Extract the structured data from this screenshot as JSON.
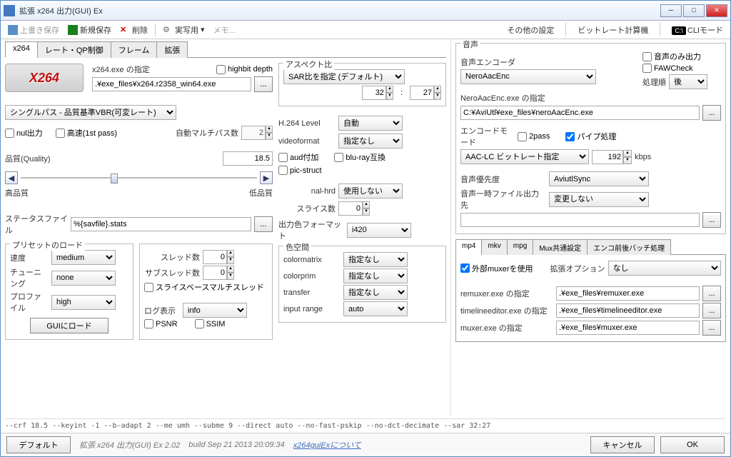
{
  "window": {
    "title": "拡張 x264 出力(GUI) Ex"
  },
  "toolbar": {
    "save": "上書き保存",
    "newsave": "新規保存",
    "delete": "削除",
    "preset": "実写用",
    "memo": "メモ...",
    "other_settings": "その他の設定",
    "bitrate_calc": "ビットレート計算機",
    "cli_mode": "CLIモード"
  },
  "tabs": {
    "x264": "x264",
    "rate": "レート・QP制御",
    "frame": "フレーム",
    "ext": "拡張"
  },
  "logo_text": "X264",
  "x264exe": {
    "label": "x264.exe の指定",
    "highbit": "highbit depth",
    "path": ".¥exe_files¥x264.r2358_win64.exe"
  },
  "mode_combo": "シングルパス - 品質基準VBR(可変レート)",
  "nul": "nul出力",
  "fast": "高速(1st pass)",
  "automulti": {
    "label": "自動マルチパス数",
    "value": "2"
  },
  "quality": {
    "label": "品質(Quality)",
    "value": "18.5",
    "left": "高品質",
    "right": "低品質"
  },
  "stats": {
    "label": "ステータスファイル",
    "value": "%{savfile}.stats"
  },
  "preset_group": {
    "title": "プリセットのロード",
    "speed_lbl": "速度",
    "speed": "medium",
    "tune_lbl": "チューニング",
    "tune": "none",
    "profile_lbl": "プロファイル",
    "profile": "high",
    "load_btn": "GUIにロード"
  },
  "thread_group": {
    "thread_lbl": "スレッド数",
    "thread": "0",
    "sub_lbl": "サブスレッド数",
    "sub": "0",
    "slice_thread": "スライスベースマルチスレッド",
    "log_lbl": "ログ表示",
    "log": "info",
    "psnr": "PSNR",
    "ssim": "SSIM"
  },
  "aspect": {
    "title": "アスペクト比",
    "mode": "SAR比を指定 (デフォルト)",
    "w": "32",
    "h": "27",
    "colon": ":"
  },
  "h264": {
    "level_lbl": "H.264 Level",
    "level": "自動",
    "vf_lbl": "videoformat",
    "vf": "指定なし",
    "aud": "aud付加",
    "bluray": "blu-ray互換",
    "pic": "pic-struct",
    "nalhrd_lbl": "nal-hrd",
    "nalhrd": "使用しない",
    "slice_lbl": "スライス数",
    "slice": "0",
    "outfmt_lbl": "出力色フォーマット",
    "outfmt": "i420"
  },
  "color": {
    "title": "色空間",
    "matrix_lbl": "colormatrix",
    "matrix": "指定なし",
    "prim_lbl": "colorprim",
    "prim": "指定なし",
    "transfer_lbl": "transfer",
    "transfer": "指定なし",
    "range_lbl": "input range",
    "range": "auto"
  },
  "audio": {
    "title": "音声",
    "encoder_lbl": "音声エンコーダ",
    "encoder": "NeroAacEnc",
    "audio_only": "音声のみ出力",
    "fawcheck": "FAWCheck",
    "order_lbl": "処理順",
    "order": "後",
    "exe_lbl": "NeroAacEnc.exe の指定",
    "exe": "C:¥AviUtl¥exe_files¥neroAacEnc.exe",
    "encmode_lbl": "エンコードモード",
    "encmode": "AAC-LC ビットレート指定",
    "twopass": "2pass",
    "pipe": "パイプ処理",
    "bitrate": "192",
    "kbps": "kbps",
    "priority_lbl": "音声優先度",
    "priority": "AviutlSync",
    "tmp_lbl": "音声一時ファイル出力先",
    "tmp": "変更しない",
    "tmp_path": ""
  },
  "mux_tabs": {
    "mp4": "mp4",
    "mkv": "mkv",
    "mpg": "mpg",
    "common": "Mux共通設定",
    "batch": "エンコ前後バッチ処理"
  },
  "mux": {
    "use_ext": "外部muxerを使用",
    "extopt_lbl": "拡張オプション",
    "extopt": "なし",
    "remux_lbl": "remuxer.exe の指定",
    "remux": ".¥exe_files¥remuxer.exe",
    "tl_lbl": "timelineeditor.exe の指定",
    "tl": ".¥exe_files¥timelineeditor.exe",
    "muxer_lbl": "muxer.exe の指定",
    "muxer": ".¥exe_files¥muxer.exe"
  },
  "cmdline": "--crf 18.5 --keyint -1 --b-adapt 2 --me umh --subme 9 --direct auto --no-fast-pskip --no-dct-decimate --sar 32:27",
  "footer": {
    "default_btn": "デフォルト",
    "appver": "拡張 x264 出力(GUI) Ex 2.02",
    "build": "build Sep 21 2013 20:09:34",
    "about": "x264guiExについて",
    "cancel": "キャンセル",
    "ok": "OK"
  }
}
